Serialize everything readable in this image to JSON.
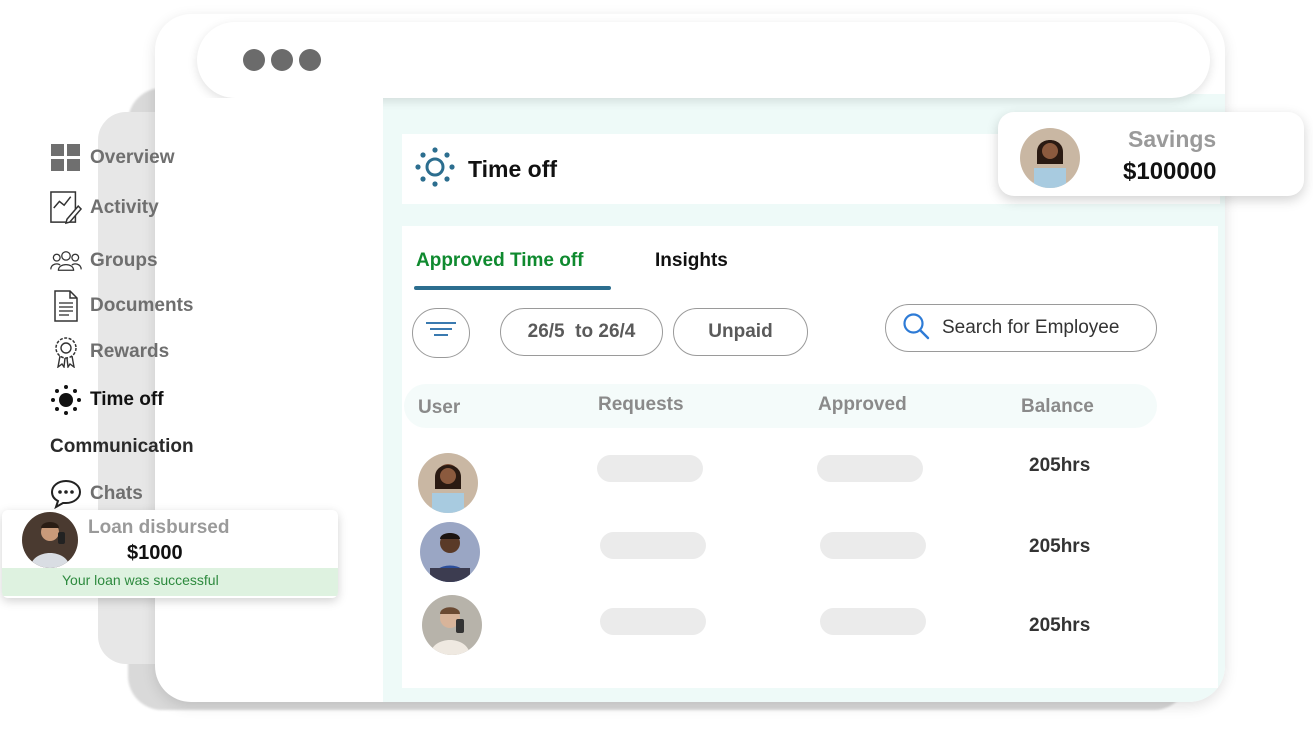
{
  "titlebar": {
    "dots": 3
  },
  "sidebar": {
    "items": [
      {
        "label": "Overview",
        "icon": "grid-icon"
      },
      {
        "label": "Activity",
        "icon": "activity-chart-icon"
      },
      {
        "label": "Groups",
        "icon": "users-group-icon"
      },
      {
        "label": "Documents",
        "icon": "document-icon"
      },
      {
        "label": "Rewards",
        "icon": "award-badge-icon"
      },
      {
        "label": "Time off",
        "icon": "sun-dots-icon",
        "active": true
      }
    ],
    "section_heading": "Communication",
    "communication_items": [
      {
        "label": "Chats",
        "icon": "chat-bubble-icon"
      }
    ]
  },
  "header": {
    "title": "Time off",
    "icon": "time-off-icon"
  },
  "tabs": [
    {
      "label": "Approved Time off",
      "active": true
    },
    {
      "label": "Insights",
      "active": false
    }
  ],
  "filters": {
    "filter_icon": "filter-lines-icon",
    "date_range": "26/5  to 26/4",
    "type": "Unpaid"
  },
  "search": {
    "placeholder": "Search for Employee"
  },
  "table": {
    "columns": [
      "User",
      "Requests",
      "Approved",
      "Balance"
    ],
    "rows": [
      {
        "avatar": "avatar-woman-laptop",
        "balance": "205hrs"
      },
      {
        "avatar": "avatar-man-blue-shirt",
        "balance": "205hrs"
      },
      {
        "avatar": "avatar-man-phone",
        "balance": "205hrs"
      }
    ]
  },
  "savings_card": {
    "label": "Savings",
    "value": "$100000"
  },
  "loan_card": {
    "title": "Loan disbursed",
    "amount": "$1000",
    "message": "Your loan was successful"
  },
  "colors": {
    "accent_green": "#0f8a2f",
    "tab_underline": "#2c6e8f",
    "icon_blue": "#2c6e8f",
    "panel_tint": "#eefaf8"
  }
}
